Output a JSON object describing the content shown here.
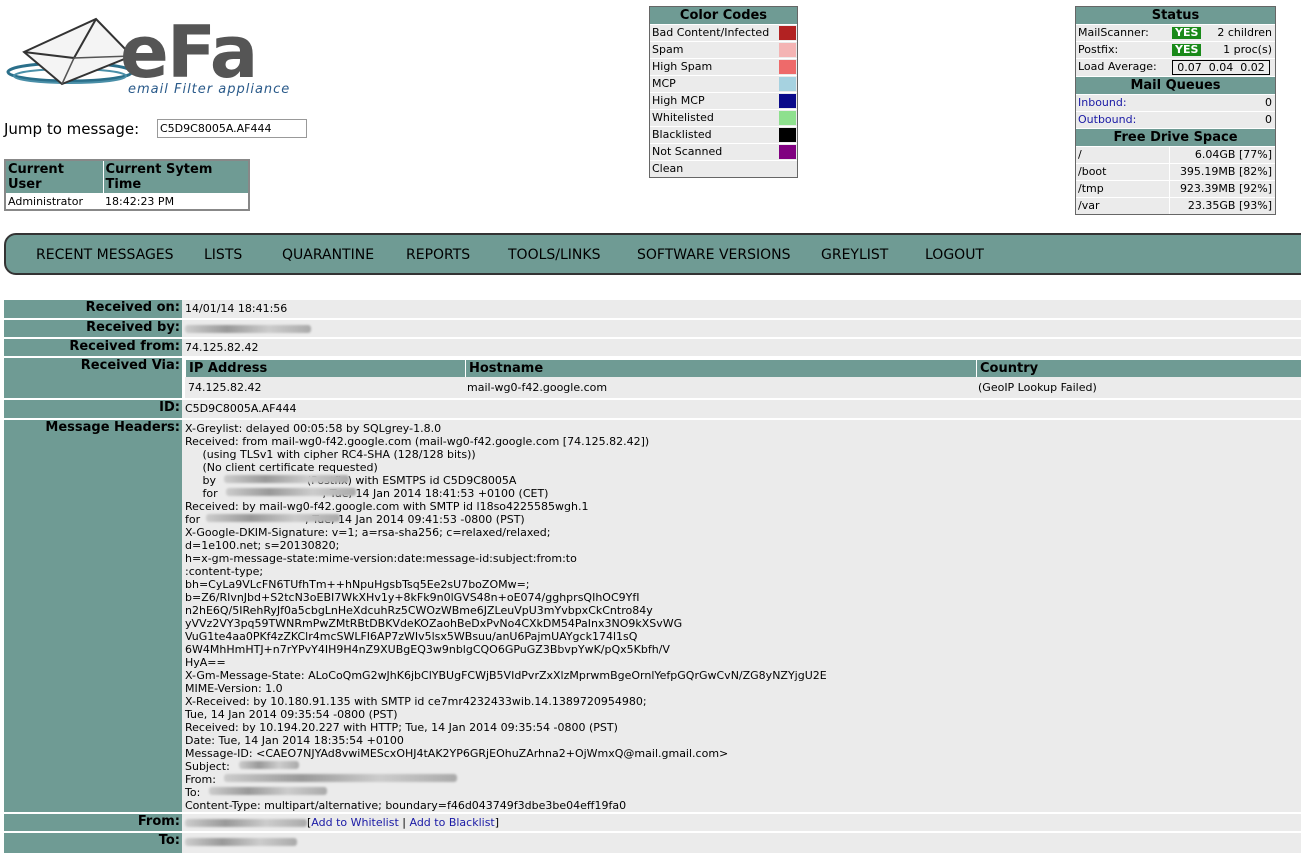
{
  "logo": {
    "brand": "eFa",
    "tagline": "email Filter appliance"
  },
  "jump": {
    "label": "Jump to message:",
    "value": "C5D9C8005A.AF444"
  },
  "user_table": {
    "headers": [
      "Current User",
      "Current Sytem Time"
    ],
    "user": "Administrator",
    "time": "18:42:23 PM"
  },
  "color_codes": {
    "title": "Color Codes",
    "items": [
      {
        "label": "Bad Content/Infected",
        "color": "#b22222"
      },
      {
        "label": "Spam",
        "color": "#f4b4b4"
      },
      {
        "label": "High Spam",
        "color": "#ee6a6a"
      },
      {
        "label": "MCP",
        "color": "#a6d2e0"
      },
      {
        "label": "High MCP",
        "color": "#0a0a8a"
      },
      {
        "label": "Whitelisted",
        "color": "#8ee08e"
      },
      {
        "label": "Blacklisted",
        "color": "#000000"
      },
      {
        "label": "Not Scanned",
        "color": "#800080"
      },
      {
        "label": "Clean",
        "color": "#ebebeb"
      }
    ]
  },
  "status": {
    "title": "Status",
    "mailscanner_label": "MailScanner:",
    "mailscanner_state": "YES",
    "mailscanner_info": "2 children",
    "postfix_label": "Postfix:",
    "postfix_state": "YES",
    "postfix_info": "1 proc(s)",
    "load_label": "Load Average:",
    "load_values": "0.07  0.04  0.02",
    "queues_title": "Mail Queues",
    "inbound_label": "Inbound:",
    "inbound_value": "0",
    "outbound_label": "Outbound:",
    "outbound_value": "0",
    "drive_title": "Free Drive Space",
    "drives": [
      {
        "mount": "/",
        "free": "6.04GB [77%]"
      },
      {
        "mount": "/boot",
        "free": "395.19MB [82%]"
      },
      {
        "mount": "/tmp",
        "free": "923.39MB [92%]"
      },
      {
        "mount": "/var",
        "free": "23.35GB [93%]"
      }
    ]
  },
  "nav": [
    "RECENT MESSAGES",
    "LISTS",
    "QUARANTINE",
    "REPORTS",
    "TOOLS/LINKS",
    "SOFTWARE VERSIONS",
    "GREYLIST",
    "LOGOUT"
  ],
  "detail": {
    "received_on_label": "Received on:",
    "received_on": "14/01/14 18:41:56",
    "received_by_label": "Received by:",
    "received_from_label": "Received from:",
    "received_from": "74.125.82.42",
    "received_via_label": "Received Via:",
    "via_headers": [
      "IP Address",
      "Hostname",
      "Country"
    ],
    "via_row": [
      "74.125.82.42",
      "mail-wg0-f42.google.com",
      "(GeoIP Lookup Failed)"
    ],
    "id_label": "ID:",
    "id": "C5D9C8005A.AF444",
    "headers_label": "Message Headers:",
    "headers_text": "X-Greylist: delayed 00:05:58 by SQLgrey-1.8.0\nReceived: from mail-wg0-f42.google.com (mail-wg0-f42.google.com [74.125.82.42])\n     (using TLSv1 with cipher RC4-SHA (128/128 bits))\n     (No client certificate requested)\n     by                          (Postfix) with ESMTPS id C5D9C8005A\n     for                              ; Tue, 14 Jan 2014 18:41:53 +0100 (CET)\nReceived: by mail-wg0-f42.google.com with SMTP id l18so4225585wgh.1\nfor                              ; Tue, 14 Jan 2014 09:41:53 -0800 (PST)\nX-Google-DKIM-Signature: v=1; a=rsa-sha256; c=relaxed/relaxed;\nd=1e100.net; s=20130820;\nh=x-gm-message-state:mime-version:date:message-id:subject:from:to\n:content-type;\nbh=CyLa9VLcFN6TUfhTm++hNpuHgsbTsq5Ee2sU7boZOMw=;\nb=Z6/RIvnJbd+S2tcN3oEBI7WkXHv1y+8kFk9n0lGVS48n+oE074/gghprsQIhOC9YfI\nn2hE6Q/5IRehRyJf0a5cbgLnHeXdcuhRz5CWOzWBme6JZLeuVpU3mYvbpxCkCntro84y\nyVVz2VY3pq59TWNRmPwZMtRBtDBKVdeKOZaohBeDxPvNo4CXkDM54PaInx3NO9kXSvWG\nVuG1te4aa0PKf4zZKClr4mcSWLFI6AP7zWIv5lsx5WBsuu/anU6PajmUAYgck174l1sQ\n6W4MhHmHTJ+n7rYPvY4IH9H4nZ9XUBgEQ3w9nblgCQO6GPuGZ3BbvpYwK/pQx5Kbfh/V\nHyA==\nX-Gm-Message-State: ALoCoQmG2wJhK6jbClYBUgFCWjB5VIdPvrZxXlzMprwmBgeOrnlYefpGQrGwCvN/ZG8yNZYjgU2E\nMIME-Version: 1.0\nX-Received: by 10.180.91.135 with SMTP id ce7mr4232433wib.14.1389720954980;\nTue, 14 Jan 2014 09:35:54 -0800 (PST)\nReceived: by 10.194.20.227 with HTTP; Tue, 14 Jan 2014 09:35:54 -0800 (PST)\nDate: Tue, 14 Jan 2014 18:35:54 +0100\nMessage-ID: <CAEO7NJYAd8vwiMEScxOHJ4tAK2YP6GRjEOhuZArhna2+OjWmxQ@mail.gmail.com>\nSubject:\nFrom:\nTo:\nContent-Type: multipart/alternative; boundary=f46d043749f3dbe3be04eff19fa0",
    "from_label": "From:",
    "add_whitelist": "Add to Whitelist",
    "add_blacklist": "Add to Blacklist",
    "to_label": "To:"
  }
}
